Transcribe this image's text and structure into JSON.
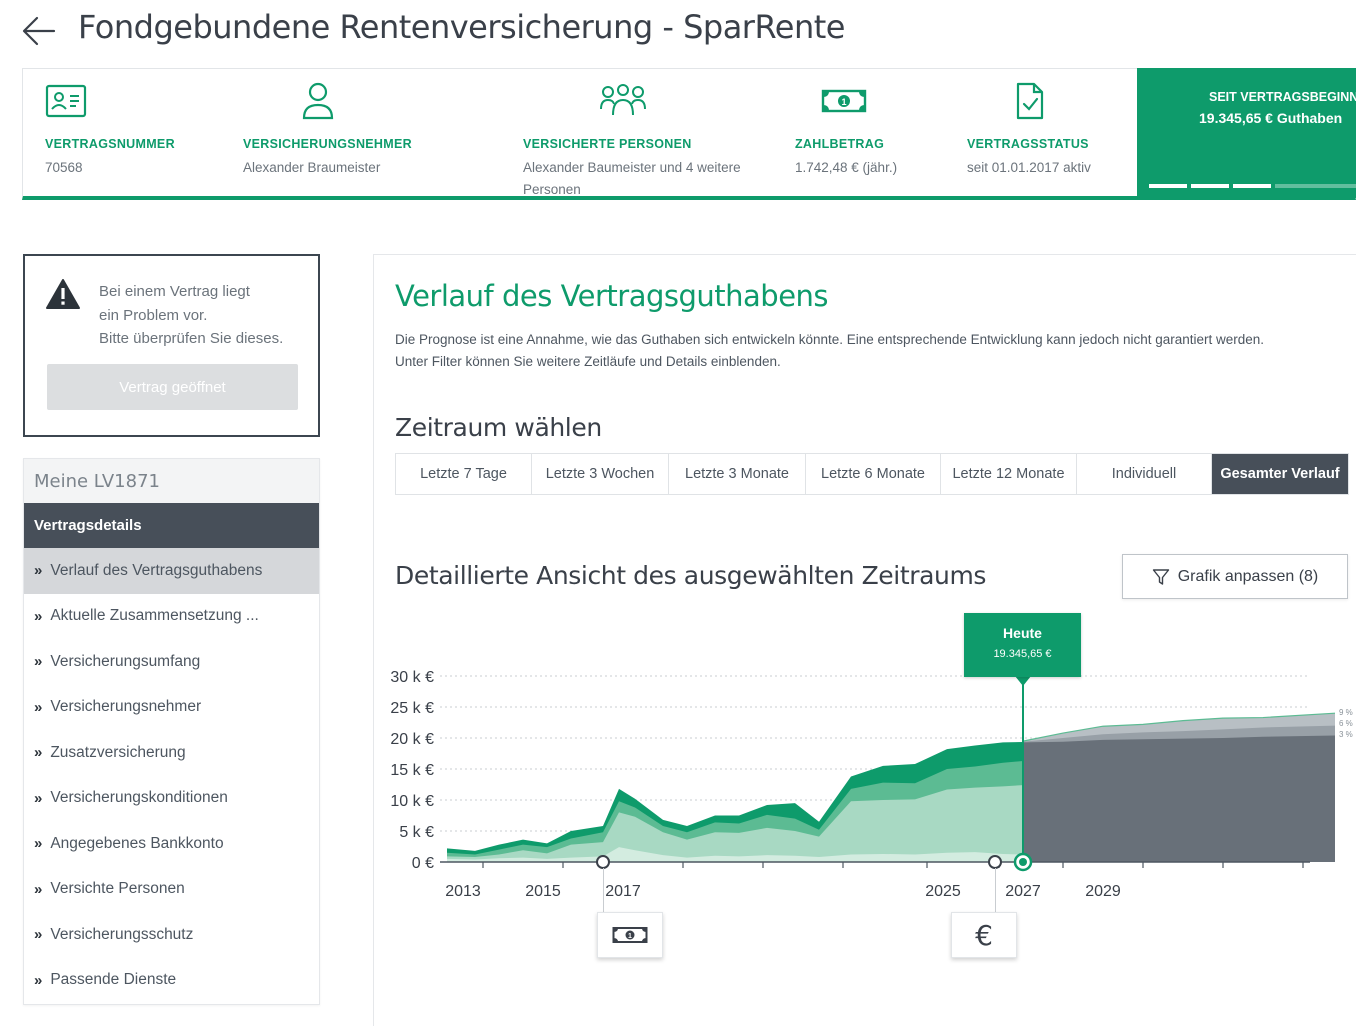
{
  "header": {
    "title": "Fondgebundene Rentenversicherung - SparRente"
  },
  "info": {
    "items": [
      {
        "label": "VERTRAGSNUMMER",
        "value": "70568",
        "icon": "id-card-icon"
      },
      {
        "label": "VERSICHERUNGSNEHMER",
        "value": "Alexander Braumeister",
        "icon": "person-icon"
      },
      {
        "label": "VERSICHERTE PERSONEN",
        "value": "Alexander Baumeister und 4 weitere Personen",
        "icon": "group-icon"
      },
      {
        "label": "ZAHLBETRAG",
        "value": "1.742,48 € (jähr.)",
        "icon": "banknote-icon"
      },
      {
        "label": "VERTRAGSSTATUS",
        "value": "seit 01.01.2017 aktiv",
        "icon": "document-check-icon"
      }
    ],
    "since": {
      "label": "SEIT VERTRAGSBEGINN",
      "value": "19.345,65 €  Guthaben",
      "progress_segments_filled": 3
    }
  },
  "alert": {
    "text_line1": "Bei einem Vertrag liegt",
    "text_line2": "ein Problem vor.",
    "text_line3": "Bitte überprüfen Sie dieses.",
    "button": "Vertrag geöffnet"
  },
  "nav": {
    "head": "Meine LV1871",
    "section": "Vertragsdetails",
    "items": [
      {
        "label": "Verlauf des Vertragsguthabens",
        "active": true
      },
      {
        "label": "Aktuelle Zusammensetzung ..."
      },
      {
        "label": "Versicherungsumfang"
      },
      {
        "label": "Versicherungsnehmer"
      },
      {
        "label": "Zusatzversicherung"
      },
      {
        "label": "Versicherungskonditionen"
      },
      {
        "label": "Angegebenes Bankkonto"
      },
      {
        "label": "Versichte Personen"
      },
      {
        "label": "Versicherungsschutz"
      },
      {
        "label": "Passende Dienste"
      }
    ],
    "chevron": "»"
  },
  "main": {
    "title": "Verlauf des Vertragsguthabens",
    "desc_line1": "Die Prognose ist eine Annahme, wie das Guthaben sich entwickeln könnte. Eine entsprechende Entwicklung kann jedoch nicht garantiert werden.",
    "desc_line2": "Unter Filter können Sie weitere Zeitläufe und Details einblenden.",
    "range_title": "Zeitraum wählen",
    "ranges": [
      {
        "label": "Letzte 7 Tage"
      },
      {
        "label": "Letzte 3 Wochen"
      },
      {
        "label": "Letzte 3 Monate"
      },
      {
        "label": "Letzte 6 Monate"
      },
      {
        "label": "Letzte 12 Monate"
      },
      {
        "label": "Individuell"
      },
      {
        "label": "Gesamter Verlauf",
        "active": true
      }
    ],
    "detail_title": "Detaillierte Ansicht des ausgewählten Zeitraums",
    "adjust_button": "Grafik anpassen (8)"
  },
  "tooltip": {
    "title": "Heute",
    "value": "19.345,65 €"
  },
  "colors": {
    "accent": "#0e9b6b",
    "dark": "#474f59",
    "forecast": "#687079",
    "area_light": "#a8d9c3",
    "area_mid": "#5cbb93"
  },
  "chart_data": {
    "type": "area",
    "ylabel_ticks": [
      "0 €",
      "5 k €",
      "10 k €",
      "15 k €",
      "20 k €",
      "25 k €",
      "30 k €"
    ],
    "y_values": [
      0,
      5000,
      10000,
      15000,
      20000,
      25000,
      30000
    ],
    "ylim": [
      0,
      30000
    ],
    "x_tick_labels": [
      {
        "label": "2013",
        "x": 2013
      },
      {
        "label": "2015",
        "x": 2015
      },
      {
        "label": "2017",
        "x": 2017
      },
      {
        "label": "2025",
        "x": 2025
      },
      {
        "label": "2027",
        "x": 2027
      },
      {
        "label": "2029",
        "x": 2029
      }
    ],
    "today_x": 2027,
    "series": [
      {
        "name": "outer",
        "x": [
          2012.6,
          2013.3,
          2013.9,
          2014.5,
          2015.1,
          2015.7,
          2016.5,
          2016.9,
          2017.3,
          2018,
          2018.6,
          2019.3,
          2019.9,
          2020.6,
          2021.3,
          2021.9,
          2022.7,
          2023.5,
          2024.3,
          2025.1,
          2025.8,
          2026.5,
          2027
        ],
        "y": [
          2200,
          1800,
          2800,
          3600,
          3000,
          5000,
          5800,
          11800,
          10200,
          6800,
          5800,
          7500,
          7500,
          9200,
          9500,
          6500,
          13800,
          15500,
          15800,
          18200,
          18800,
          19300,
          19350
        ]
      },
      {
        "name": "middle",
        "x": [
          2012.6,
          2013.3,
          2013.9,
          2014.5,
          2015.1,
          2015.7,
          2016.5,
          2016.9,
          2017.3,
          2018,
          2018.6,
          2019.3,
          2019.9,
          2020.6,
          2021.3,
          2021.9,
          2022.7,
          2023.5,
          2024.3,
          2025.1,
          2025.8,
          2026.5,
          2027
        ],
        "y": [
          1500,
          1200,
          2000,
          2800,
          2400,
          3800,
          4800,
          9800,
          8800,
          5800,
          4800,
          6400,
          6200,
          7600,
          7000,
          5200,
          11800,
          12800,
          12700,
          15000,
          15400,
          16000,
          16300
        ]
      },
      {
        "name": "inner",
        "x": [
          2012.6,
          2013.3,
          2013.9,
          2014.5,
          2015.1,
          2015.7,
          2016.5,
          2016.9,
          2017.3,
          2018,
          2018.6,
          2019.3,
          2019.9,
          2020.6,
          2021.3,
          2021.9,
          2022.7,
          2023.5,
          2024.3,
          2025.1,
          2025.8,
          2026.5,
          2027
        ],
        "y": [
          900,
          800,
          1200,
          1900,
          1400,
          2800,
          3200,
          8000,
          7300,
          4800,
          3600,
          4800,
          4700,
          5500,
          5000,
          4100,
          9800,
          10000,
          10100,
          11700,
          12000,
          12200,
          12400
        ]
      },
      {
        "name": "base",
        "x": [
          2012.6,
          2013.3,
          2013.9,
          2014.5,
          2015.1,
          2015.7,
          2016.5,
          2016.9,
          2017.3,
          2018,
          2018.6,
          2019.3,
          2019.9,
          2020.6,
          2021.3,
          2021.9,
          2022.7,
          2023.5,
          2024.3,
          2025.1,
          2025.8,
          2026.5,
          2027
        ],
        "y": [
          500,
          400,
          600,
          700,
          500,
          700,
          900,
          2400,
          1900,
          1100,
          700,
          1000,
          900,
          1100,
          1000,
          800,
          1200,
          1300,
          1200,
          1500,
          1600,
          1300,
          1200
        ]
      },
      {
        "name": "9 %",
        "x": [
          2027,
          2028,
          2029,
          2030,
          2031,
          2032,
          2033,
          2034.8
        ],
        "y": [
          19500,
          20800,
          21900,
          22200,
          22800,
          23200,
          23300,
          24000
        ]
      },
      {
        "name": "6 %",
        "x": [
          2027,
          2028,
          2029,
          2030,
          2031,
          2032,
          2033,
          2034.8
        ],
        "y": [
          19400,
          20000,
          20600,
          20900,
          21100,
          21400,
          21700,
          22000
        ]
      },
      {
        "name": "3 %",
        "x": [
          2027,
          2028,
          2029,
          2030,
          2031,
          2032,
          2033,
          2034.8
        ],
        "y": [
          19300,
          19400,
          19700,
          19800,
          19900,
          20000,
          20200,
          20400
        ]
      }
    ],
    "forecast_labels": [
      "9 %",
      "6 %",
      "3 %"
    ],
    "markers": [
      {
        "x": 2016.5,
        "type": "payment",
        "icon": "banknote-icon"
      },
      {
        "x": 2026.3,
        "type": "payout",
        "icon": "euro-icon",
        "symbol": "€"
      }
    ]
  }
}
